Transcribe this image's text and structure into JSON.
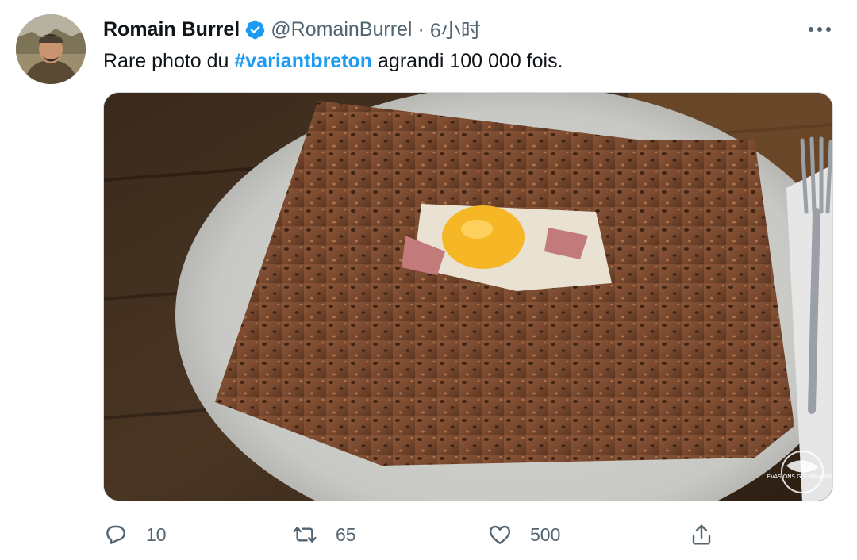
{
  "author": {
    "name": "Romain Burrel",
    "handle": "@RomainBurrel",
    "separator": "·",
    "time": "6小时"
  },
  "tweet": {
    "text_before": "Rare photo du ",
    "hashtag": "#variantbreton",
    "text_after": " agrandi 100 000 fois."
  },
  "media": {
    "description_icon": "photo-of-buckwheat-galette",
    "watermark": "EVASIONS GOURMANDES"
  },
  "actions": {
    "reply_count": "10",
    "retweet_count": "65",
    "like_count": "500"
  },
  "colors": {
    "accent": "#1d9bf0",
    "secondary_text": "#536471",
    "border": "#cfd9de"
  }
}
